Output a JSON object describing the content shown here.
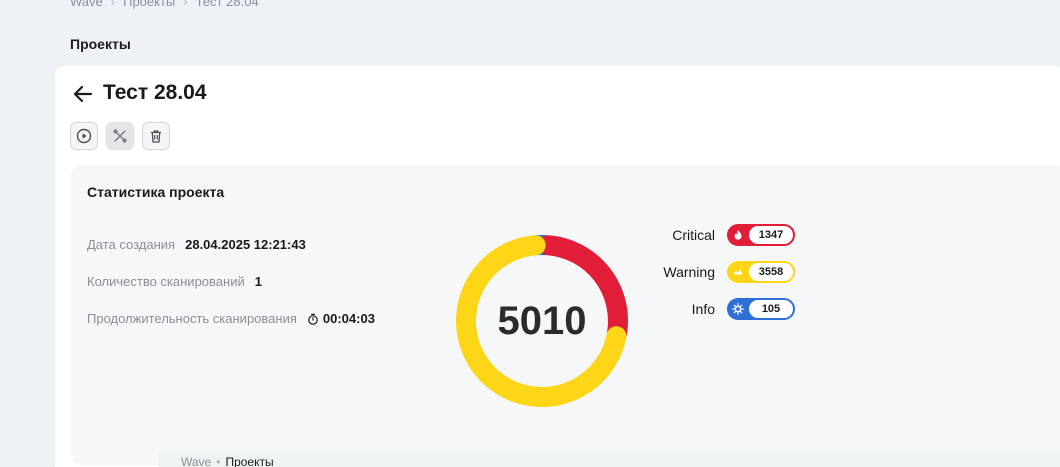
{
  "breadcrumbs": {
    "items": [
      "Wave",
      "Проекты",
      "Тест 28.04"
    ]
  },
  "section_title": "Проекты",
  "project": {
    "title": "Тест 28.04"
  },
  "toolbar": {
    "run_icon": "play-circle-icon",
    "settings_icon": "tools-icon",
    "delete_icon": "trash-icon"
  },
  "stats": {
    "title": "Статистика проекта",
    "created_label": "Дата создания",
    "created_value": "28.04.2025 12:21:43",
    "scans_label": "Количество сканирований",
    "scans_value": "1",
    "duration_label": "Продолжительность сканирования",
    "duration_value": "00:04:03",
    "total": "5010"
  },
  "severity": [
    {
      "name": "Critical",
      "count": 1347,
      "color": "#e21d37",
      "icon": "flame-icon"
    },
    {
      "name": "Warning",
      "count": 3558,
      "color": "#fcd617",
      "icon": "warning-icon"
    },
    {
      "name": "Info",
      "count": 105,
      "color": "#2f6fd8",
      "icon": "gear-icon"
    }
  ],
  "footer_breadcrumbs": {
    "root": "Wave",
    "current": "Проекты"
  }
}
